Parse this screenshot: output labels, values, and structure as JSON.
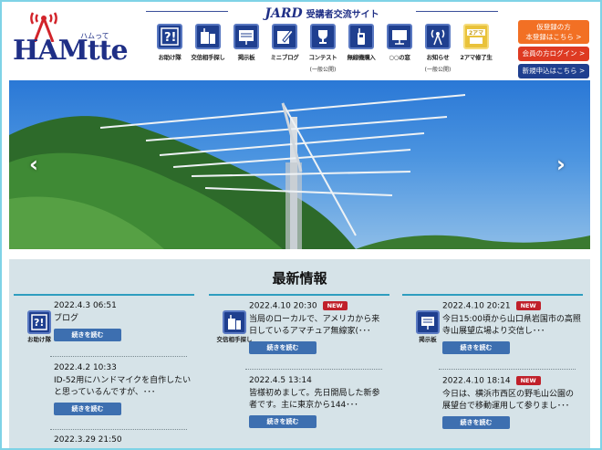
{
  "brand": {
    "logo_text": "HAMtte",
    "logo_sub": "ハムって",
    "site_mark": "JARD",
    "site_subtitle": "受講者交流サイト"
  },
  "nav": [
    {
      "label": "お助け隊",
      "icon": "question-icon",
      "note": ""
    },
    {
      "label": "交信相手探し",
      "icon": "radio-icon",
      "note": ""
    },
    {
      "label": "掲示板",
      "icon": "board-icon",
      "note": ""
    },
    {
      "label": "ミニブログ",
      "icon": "pen-icon",
      "note": ""
    },
    {
      "label": "コンテスト",
      "icon": "trophy-icon",
      "note": "(一般公開)"
    },
    {
      "label": "無線機購入",
      "icon": "handheld-radio-icon",
      "note": ""
    },
    {
      "label": "○○の窓",
      "icon": "window-icon",
      "note": ""
    },
    {
      "label": "お知らせ",
      "icon": "antenna-icon",
      "note": "(一般公開)"
    },
    {
      "label": "2アマ修了生",
      "icon": "badge-2ama-icon",
      "note": ""
    }
  ],
  "nav_badge_text": "2アマ",
  "side_buttons": {
    "provisional_line1": "仮登録の方",
    "provisional_line2": "本登録はこちら >",
    "login": "会員の方ログイン >",
    "signup": "新規申込はこちら >"
  },
  "slider": {
    "prev": "‹",
    "next": "›"
  },
  "news": {
    "title": "最新情報",
    "more_label": "続きを読む",
    "new_label": "NEW",
    "columns": [
      {
        "category": "お助け隊",
        "icon": "question-icon",
        "entries": [
          {
            "date": "2022.4.3 06:51",
            "text": "ブログ",
            "new": false
          },
          {
            "date": "2022.4.2 10:33",
            "text": "ID-52用にハンドマイクを自作したいと思っているんですが、･･･",
            "new": false
          },
          {
            "date": "2022.3.29 21:50",
            "text": "",
            "new": false
          }
        ]
      },
      {
        "category": "交信相手探し",
        "icon": "radio-icon",
        "entries": [
          {
            "date": "2022.4.10 20:30",
            "text": "当局のローカルで、アメリカから来日しているアマチュア無線家(･･･",
            "new": true
          },
          {
            "date": "2022.4.5 13:14",
            "text": "皆様初めまして。先日開局した新参者です。主に東京から144･･･",
            "new": false
          }
        ]
      },
      {
        "category": "掲示板",
        "icon": "board-icon",
        "entries": [
          {
            "date": "2022.4.10 20:21",
            "text": "今日15:00頃から山口県岩国市の高照寺山展望広場より交信し･･･",
            "new": true
          },
          {
            "date": "2022.4.10 18:14",
            "text": "今日は、横浜市西区の野毛山公園の展望台で移動運用して参りまし･･･",
            "new": true
          }
        ]
      }
    ]
  }
}
